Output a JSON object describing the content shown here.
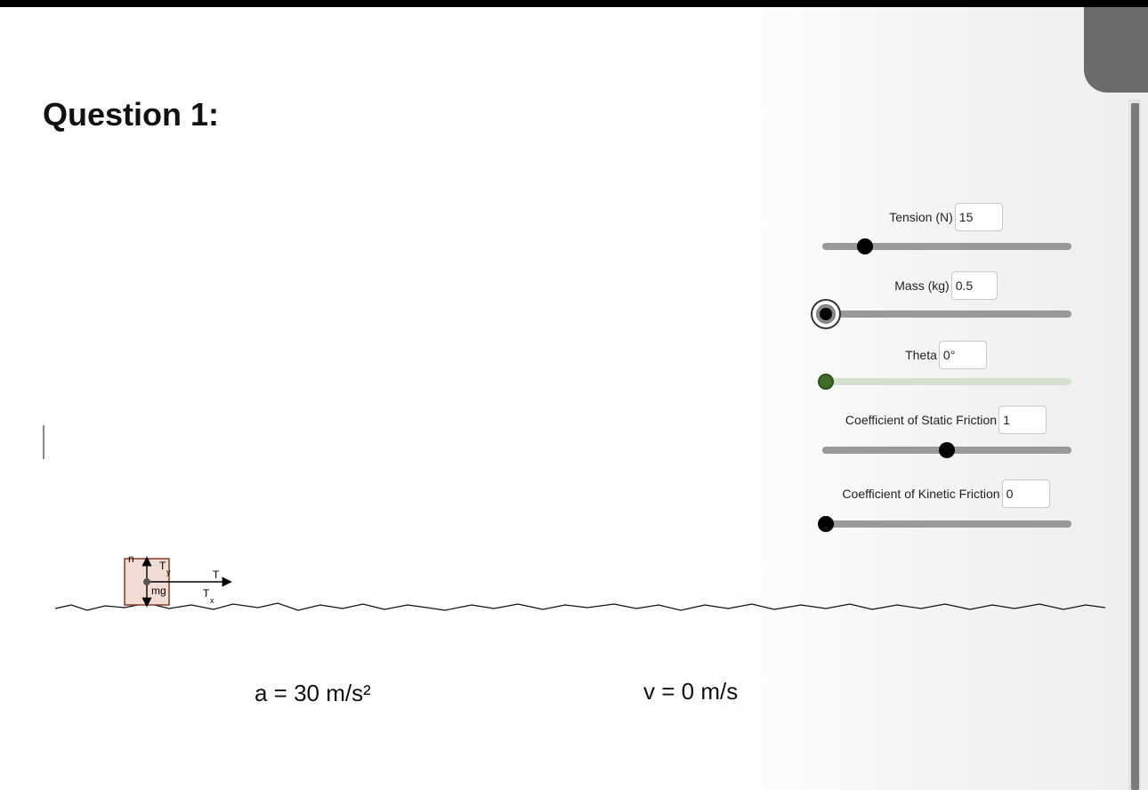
{
  "question": {
    "title": "Question 1:"
  },
  "controls": {
    "tension": {
      "label": "Tension (N)",
      "value": "15",
      "level": 0.16
    },
    "mass": {
      "label": "Mass (kg)",
      "value": "0.5",
      "level": 0.0
    },
    "theta": {
      "label": "Theta",
      "value": "0°",
      "level": 0.0
    },
    "static_friction": {
      "label": "Coefficient of Static Friction",
      "value": "1",
      "level": 0.5
    },
    "kinetic_friction": {
      "label": "Coefficient of Kinetic Friction",
      "value": "0",
      "level": 0.0
    }
  },
  "diagram": {
    "labels": {
      "normal": "n",
      "tension_y": "T",
      "tension_y_sub": "y",
      "weight": "mg",
      "tension": "T",
      "tension_x": "T",
      "tension_x_sub": "x"
    }
  },
  "readouts": {
    "acceleration": "a = 30 m/s²",
    "velocity": "v = 0 m/s"
  },
  "colors": {
    "block_fill": "#f1dcd6",
    "block_border": "#8a3b20",
    "knob": "#000000",
    "theta_knob": "#3f6b2a",
    "track": "#999999",
    "theta_track": "#d4e1cf"
  }
}
